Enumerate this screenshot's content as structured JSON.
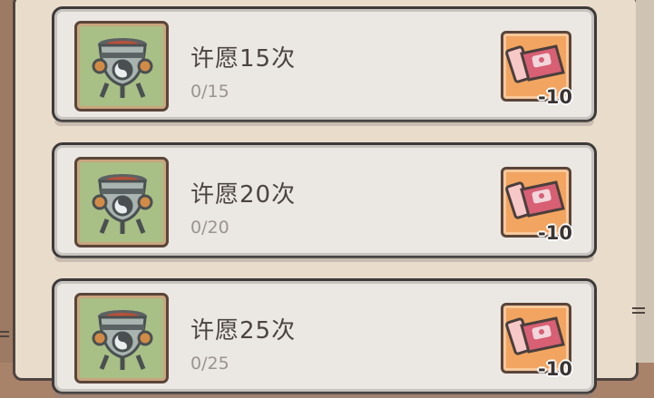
{
  "tasks": [
    {
      "title": "许愿15次",
      "progress": "0/15",
      "reward": {
        "icon": "ticket-icon",
        "count": "-10"
      }
    },
    {
      "title": "许愿20次",
      "progress": "0/20",
      "reward": {
        "icon": "ticket-icon",
        "count": "-10"
      }
    },
    {
      "title": "许愿25次",
      "progress": "0/25",
      "reward": {
        "icon": "ticket-icon",
        "count": "-10"
      }
    }
  ],
  "colors": {
    "card_bg": "#ebe7e2",
    "thumb_bg": "#a8bf86",
    "reward_bg": "#f2a561",
    "title_text": "#4b4442",
    "progress_text": "#9a9491"
  }
}
